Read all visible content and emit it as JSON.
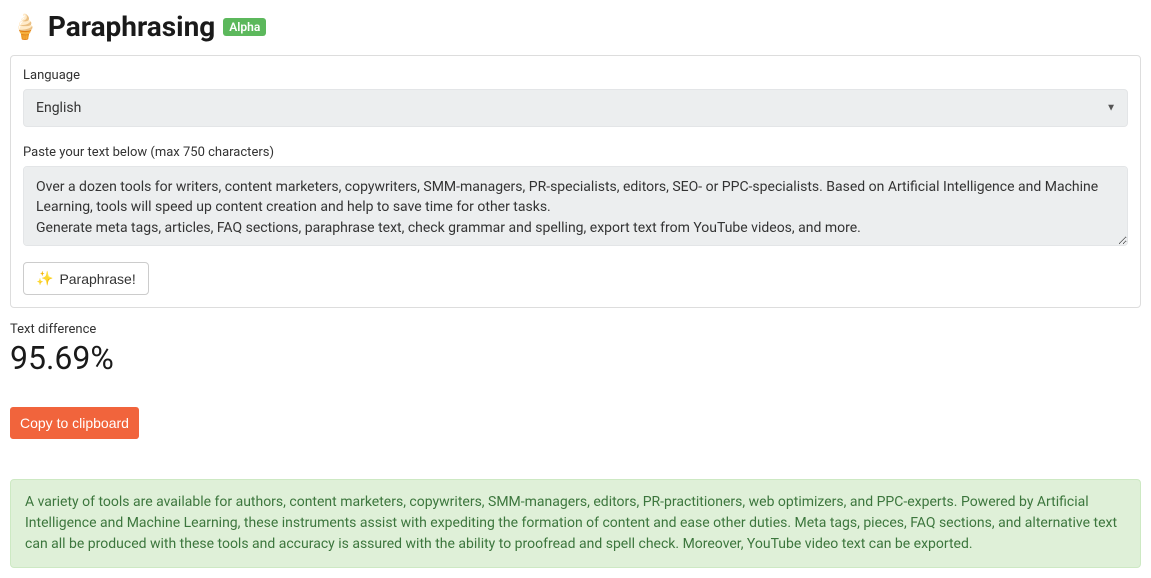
{
  "header": {
    "icon": "🍦",
    "title": "Paraphrasing",
    "badge": "Alpha"
  },
  "form": {
    "language_label": "Language",
    "language_value": "English",
    "textarea_label": "Paste your text below (max 750 characters)",
    "textarea_value": "Over a dozen tools for writers, content marketers, copywriters, SMM-managers, PR-specialists, editors, SEO- or PPC-specialists. Based on Artificial Intelligence and Machine Learning, tools will speed up content creation and help to save time for other tasks.\nGenerate meta tags, articles, FAQ sections, paraphrase text, check grammar and spelling, export text from YouTube videos, and more.",
    "paraphrase_button_icon": "✨",
    "paraphrase_button_label": "Paraphrase!"
  },
  "diff": {
    "label": "Text difference",
    "value": "95.69%"
  },
  "copy_button": "Copy to clipboard",
  "result": {
    "text": "A variety of tools are available for authors, content marketers, copywriters, SMM-managers, editors, PR-practitioners, web optimizers, and PPC-experts. Powered by Artificial Intelligence and Machine Learning, these instruments assist with expediting the formation of content and ease other duties. Meta tags, pieces, FAQ sections, and alternative text can all be produced with these tools and accuracy is assured with the ability to proofread and spell check. Moreover, YouTube video text can be exported."
  }
}
